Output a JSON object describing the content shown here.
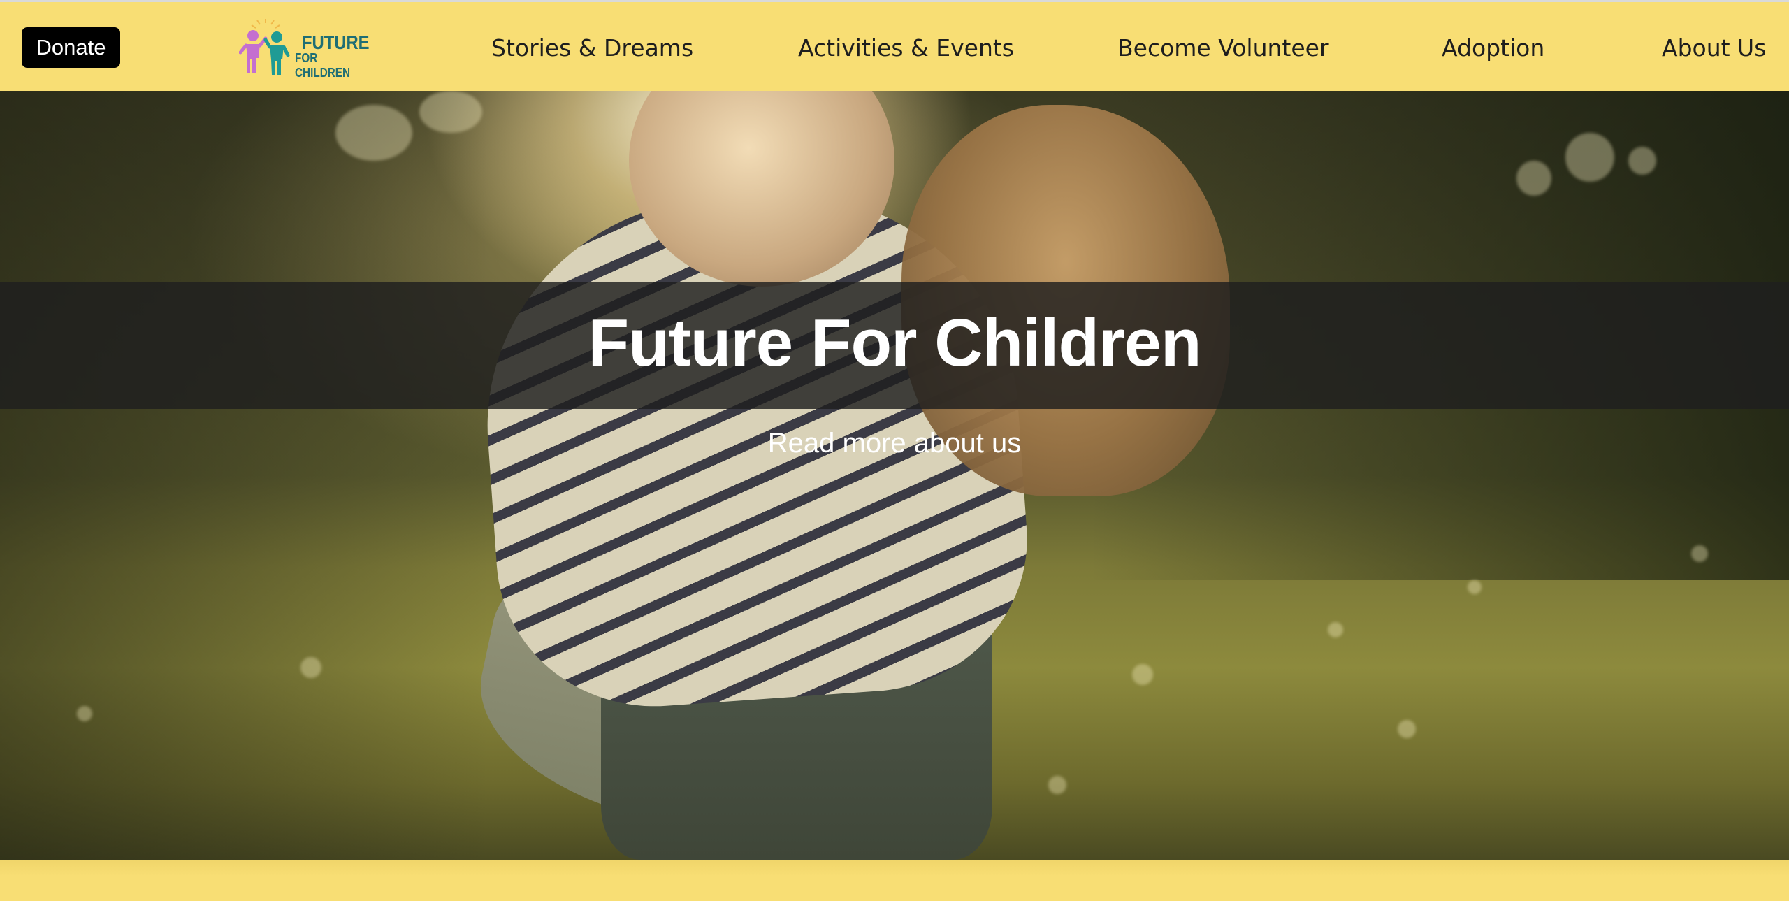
{
  "header": {
    "donate_label": "Donate",
    "logo": {
      "line1": "FUTURE",
      "line2": "FOR CHILDREN",
      "icon": "children-logo-icon"
    },
    "nav": [
      {
        "label": "Stories & Dreams"
      },
      {
        "label": "Activities & Events"
      },
      {
        "label": "Become Volunteer"
      },
      {
        "label": "Adoption"
      },
      {
        "label": "About Us"
      }
    ]
  },
  "hero": {
    "title": "Future For Children",
    "read_more": "Read more about us"
  },
  "colors": {
    "nav_background": "#f8de74",
    "donate_background": "#000000",
    "logo_text": "#1f6e74",
    "logo_figure_left": "#c46fd0",
    "logo_figure_right": "#1f9b95",
    "title_band": "#1e1e1e"
  }
}
